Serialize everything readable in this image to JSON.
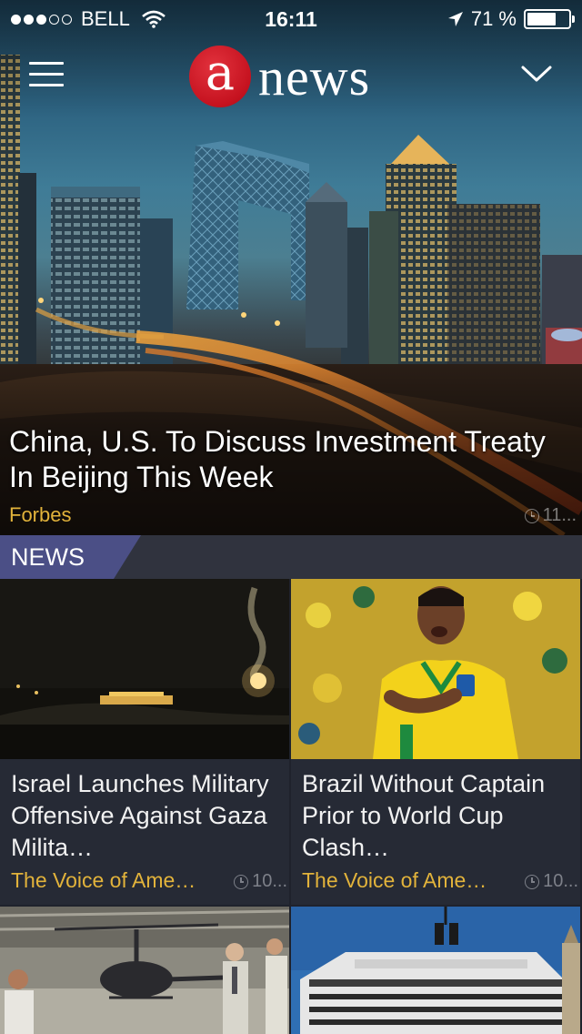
{
  "status_bar": {
    "carrier": "BELL",
    "time": "16:11",
    "battery": "71 %",
    "battery_level": 0.71,
    "signal_bars_filled": 3,
    "signal_bars_total": 5
  },
  "header": {
    "logo_letter": "a",
    "logo_word": "news",
    "menu_icon": "hamburger-icon",
    "dropdown_icon": "chevron-down-icon"
  },
  "hero": {
    "title": "China, U.S. To Discuss Investment Treaty In Beijing This Week",
    "source": "Forbes",
    "time": "11..."
  },
  "section": {
    "label": "NEWS"
  },
  "articles": [
    {
      "title": "Israel Launches Military Offensive Against Gaza Milita…",
      "source": "The Voice of Ame…",
      "time": "10..."
    },
    {
      "title": "Brazil Without Captain Prior to World Cup Clash…",
      "source": "The Voice of Ame…",
      "time": "10..."
    },
    {
      "title": "",
      "source": "",
      "time": ""
    },
    {
      "title": "",
      "source": "",
      "time": ""
    }
  ],
  "colors": {
    "accent_gold": "#e2b33b",
    "logo_red": "#c5121f",
    "section_tab": "#4b4f86",
    "card_bg": "#262a35"
  }
}
